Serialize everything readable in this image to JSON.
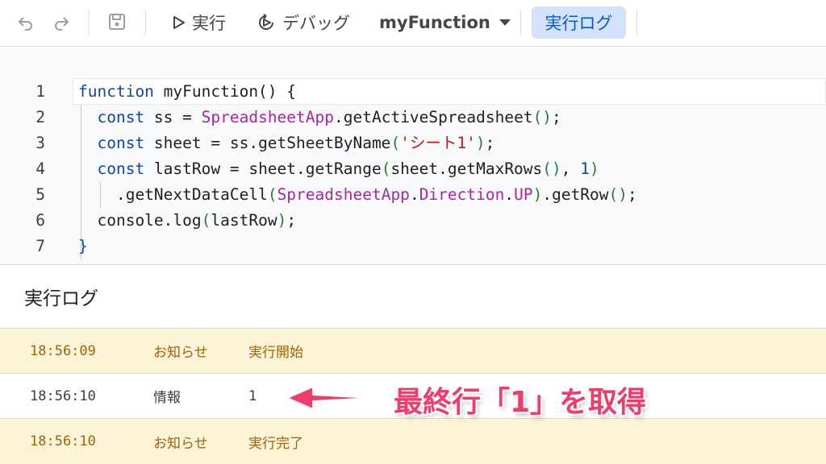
{
  "toolbar": {
    "undo_icon": "undo-icon",
    "redo_icon": "redo-icon",
    "save_icon": "save-icon",
    "run_label": "実行",
    "debug_label": "デバッグ",
    "function_select": "myFunction",
    "execution_log_label": "実行ログ"
  },
  "editor": {
    "line_numbers": [
      "1",
      "2",
      "3",
      "4",
      "5",
      "6",
      "7"
    ],
    "lines": [
      [
        {
          "t": "function",
          "c": "kw"
        },
        {
          "t": " myFunction() {",
          "c": "pun"
        }
      ],
      [
        {
          "t": "  ",
          "c": "pun"
        },
        {
          "t": "const",
          "c": "kw"
        },
        {
          "t": " ss = ",
          "c": "pun"
        },
        {
          "t": "SpreadsheetApp",
          "c": "cls"
        },
        {
          "t": ".getActiveSpreadsheet",
          "c": "pun"
        },
        {
          "t": "()",
          "c": "par"
        },
        {
          "t": ";",
          "c": "pun"
        }
      ],
      [
        {
          "t": "  ",
          "c": "pun"
        },
        {
          "t": "const",
          "c": "kw"
        },
        {
          "t": " sheet = ss.getSheetByName",
          "c": "pun"
        },
        {
          "t": "(",
          "c": "par"
        },
        {
          "t": "'シート1'",
          "c": "str"
        },
        {
          "t": ")",
          "c": "par"
        },
        {
          "t": ";",
          "c": "pun"
        }
      ],
      [
        {
          "t": "  ",
          "c": "pun"
        },
        {
          "t": "const",
          "c": "kw"
        },
        {
          "t": " lastRow = sheet.getRange",
          "c": "pun"
        },
        {
          "t": "(",
          "c": "par"
        },
        {
          "t": "sheet.getMaxRows",
          "c": "pun"
        },
        {
          "t": "()",
          "c": "par"
        },
        {
          "t": ", ",
          "c": "pun"
        },
        {
          "t": "1",
          "c": "num"
        },
        {
          "t": ")",
          "c": "par"
        }
      ],
      [
        {
          "t": "    .getNextDataCell",
          "c": "pun"
        },
        {
          "t": "(",
          "c": "par"
        },
        {
          "t": "SpreadsheetApp",
          "c": "cls"
        },
        {
          "t": ".",
          "c": "pun"
        },
        {
          "t": "Direction",
          "c": "cls"
        },
        {
          "t": ".",
          "c": "pun"
        },
        {
          "t": "UP",
          "c": "cls"
        },
        {
          "t": ")",
          "c": "par"
        },
        {
          "t": ".getRow",
          "c": "pun"
        },
        {
          "t": "()",
          "c": "par"
        },
        {
          "t": ";",
          "c": "pun"
        }
      ],
      [
        {
          "t": "  console.log",
          "c": "pun"
        },
        {
          "t": "(",
          "c": "par"
        },
        {
          "t": "lastRow",
          "c": "pun"
        },
        {
          "t": ")",
          "c": "par"
        },
        {
          "t": ";",
          "c": "pun"
        }
      ],
      [
        {
          "t": "}",
          "c": "kw"
        }
      ]
    ]
  },
  "log_panel": {
    "title": "実行ログ",
    "rows": [
      {
        "time": "18:56:09",
        "type": "お知らせ",
        "message": "実行開始",
        "level": "notice"
      },
      {
        "time": "18:56:10",
        "type": "情報",
        "message": "1",
        "level": "info"
      },
      {
        "time": "18:56:10",
        "type": "お知らせ",
        "message": "実行完了",
        "level": "notice"
      }
    ]
  },
  "annotation": {
    "text": "最終行「1」を取得",
    "color": "#ee3d6b"
  }
}
